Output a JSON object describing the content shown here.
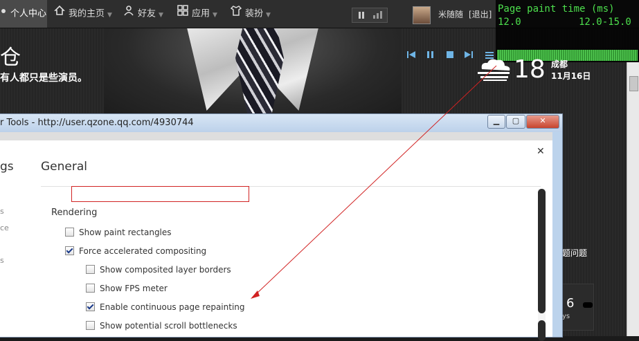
{
  "nav": {
    "items": [
      {
        "label": "个人中心",
        "icon": "user-circle-icon"
      },
      {
        "label": "我的主页",
        "icon": "home-icon"
      },
      {
        "label": "好友",
        "icon": "friends-icon"
      },
      {
        "label": "应用",
        "icon": "apps-grid-icon"
      },
      {
        "label": "装扮",
        "icon": "shirt-icon"
      }
    ],
    "user_name": "米随随",
    "logout": "[退出]"
  },
  "fps_meter": {
    "title": "Page paint time (ms)",
    "current": "12.0",
    "range": "12.0-15.0"
  },
  "hero": {
    "title": "仓",
    "subtitle": "有人都只是些演员。"
  },
  "media_controls": {
    "icons": [
      "previous-icon",
      "pause-icon",
      "stop-icon",
      "next-icon",
      "playlist-icon"
    ],
    "accent": "#6fb5e6"
  },
  "weather": {
    "icon": "cloud-fog-icon",
    "temperature": "18",
    "city": "成都",
    "date": "11月16日"
  },
  "side": {
    "text": "题问题",
    "number": "6",
    "small": "ys"
  },
  "devtools": {
    "title": "r Tools - http://user.qzone.qq.com/4930744",
    "settings_header": "gs",
    "general_label": "General",
    "left_fragments": [
      "s",
      "ce",
      "s"
    ],
    "section_label": "Rendering",
    "options": [
      {
        "label": "Show paint rectangles",
        "checked": false
      },
      {
        "label": "Force accelerated compositing",
        "checked": true
      },
      {
        "label": "Show composited layer borders",
        "checked": false
      },
      {
        "label": "Show FPS meter",
        "checked": false
      },
      {
        "label": "Enable continuous page repainting",
        "checked": true
      },
      {
        "label": "Show potential scroll bottlenecks",
        "checked": false
      }
    ],
    "highlight_color": "#d12222"
  }
}
